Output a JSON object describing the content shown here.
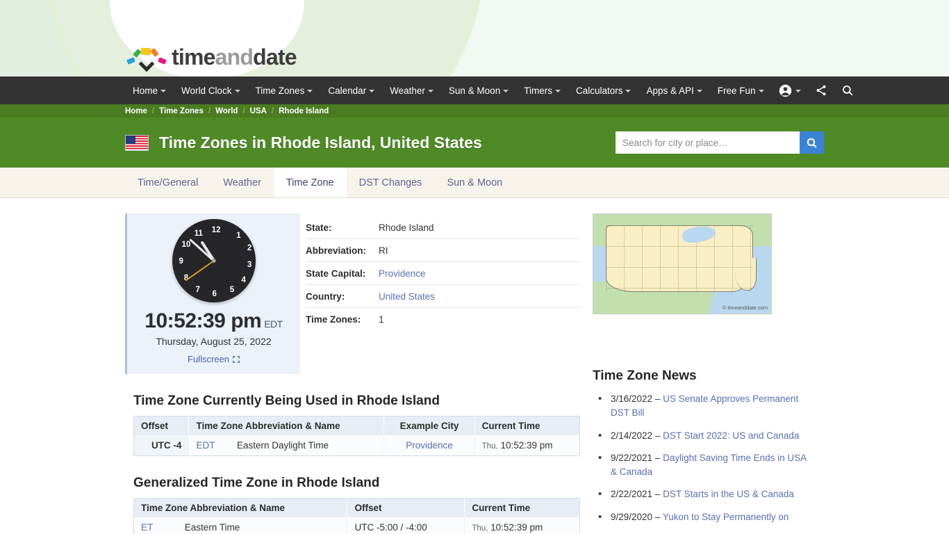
{
  "brand": {
    "part1": "time",
    "part2": "and",
    "part3": "date"
  },
  "nav": {
    "items": [
      {
        "label": "Home",
        "caret": true
      },
      {
        "label": "World Clock",
        "caret": true
      },
      {
        "label": "Time Zones",
        "caret": true
      },
      {
        "label": "Calendar",
        "caret": true
      },
      {
        "label": "Weather",
        "caret": true
      },
      {
        "label": "Sun & Moon",
        "caret": true
      },
      {
        "label": "Timers",
        "caret": true
      },
      {
        "label": "Calculators",
        "caret": true
      },
      {
        "label": "Apps & API",
        "caret": true
      },
      {
        "label": "Free Fun",
        "caret": true
      }
    ],
    "icons": [
      "account-icon",
      "share-icon",
      "search-icon"
    ]
  },
  "breadcrumb": [
    "Home",
    "Time Zones",
    "World",
    "USA",
    "Rhode Island"
  ],
  "header": {
    "title": "Time Zones in Rhode Island, United States",
    "flag": "us-flag",
    "accent_green": "#4f8a27"
  },
  "search": {
    "placeholder": "Search for city or place…",
    "value": "",
    "button_color": "#3b82d6"
  },
  "tabs": [
    {
      "label": "Time/General",
      "active": false
    },
    {
      "label": "Weather",
      "active": false
    },
    {
      "label": "Time Zone",
      "active": true
    },
    {
      "label": "DST Changes",
      "active": false
    },
    {
      "label": "Sun & Moon",
      "active": false
    }
  ],
  "clock": {
    "time": "10:52:39 pm",
    "tz_abbr": "EDT",
    "date": "Thursday, August 25, 2022",
    "fullscreen_label": "Fullscreen",
    "numerals": [
      "1",
      "2",
      "3",
      "4",
      "5",
      "6",
      "7",
      "8",
      "9",
      "10",
      "11",
      "12"
    ]
  },
  "info": [
    {
      "key": "State:",
      "value": "Rhode Island",
      "link": false
    },
    {
      "key": "Abbreviation:",
      "value": "RI",
      "link": false
    },
    {
      "key": "State Capital:",
      "value": "Providence",
      "link": true
    },
    {
      "key": "Country:",
      "value": "United States",
      "link": true
    },
    {
      "key": "Time Zones:",
      "value": "1",
      "link": false
    }
  ],
  "map": {
    "credit": "© timeanddate.com",
    "alt": "us-map"
  },
  "current_tz": {
    "heading": "Time Zone Currently Being Used in Rhode Island",
    "columns": [
      "Offset",
      "Time Zone Abbreviation & Name",
      "Example City",
      "Current Time"
    ],
    "rows": [
      {
        "offset": "UTC -4",
        "abbr": "EDT",
        "name": "Eastern Daylight Time",
        "city": "Providence",
        "dow": "Thu,",
        "time": "10:52:39 pm"
      }
    ]
  },
  "general_tz": {
    "heading": "Generalized Time Zone in Rhode Island",
    "columns": [
      "Time Zone Abbreviation & Name",
      "Offset",
      "Current Time"
    ],
    "rows": [
      {
        "abbr": "ET",
        "name": "Eastern Time",
        "offset": "UTC -5:00 / -4:00",
        "dow": "Thu,",
        "time": "10:52:39 pm"
      }
    ]
  },
  "news": {
    "heading": "Time Zone News",
    "items": [
      {
        "date": "3/16/2022 – ",
        "title": "US Senate Approves Permanent DST Bill"
      },
      {
        "date": "2/14/2022 – ",
        "title": "DST Start 2022: US and Canada"
      },
      {
        "date": "9/22/2021 – ",
        "title": "Daylight Saving Time Ends in USA & Canada"
      },
      {
        "date": "2/22/2021 – ",
        "title": "DST Starts in the US & Canada"
      },
      {
        "date": "9/29/2020 – ",
        "title": "Yukon to Stay Permanently on"
      }
    ]
  }
}
